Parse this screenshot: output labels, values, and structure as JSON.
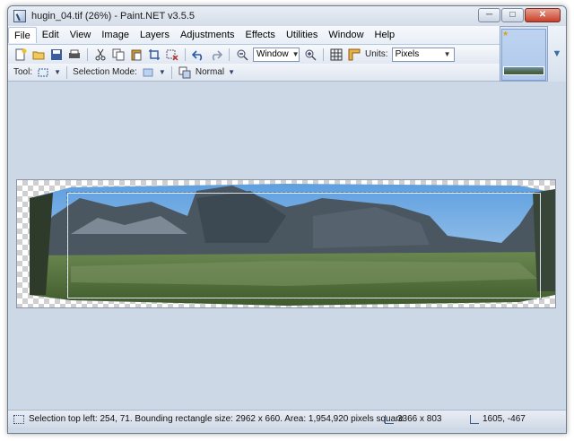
{
  "window": {
    "title": "hugin_04.tif (26%) - Paint.NET v3.5.5",
    "min_label": "─",
    "max_label": "□",
    "close_label": "✕"
  },
  "menu": {
    "items": [
      "File",
      "Edit",
      "View",
      "Image",
      "Layers",
      "Adjustments",
      "Effects",
      "Utilities",
      "Window",
      "Help"
    ]
  },
  "toolbar": {
    "zoom_value": "Window",
    "units_label": "Units:",
    "units_value": "Pixels"
  },
  "toolbar2": {
    "tool_label": "Tool:",
    "selection_mode_label": "Selection Mode:",
    "blend_value": "Normal"
  },
  "status": {
    "selection_text": "Selection top left: 254, 71. Bounding rectangle size: 2962 x 660. Area: 1,954,920 pixels square",
    "image_size": "3366 x 803",
    "cursor_pos": "1605, -467"
  },
  "colors": {
    "workspace": "#cdd8e6",
    "accent": "#3a6ea5",
    "sky": "#7fb0e0",
    "grass": "#4f6f3a",
    "rock": "#4a5660"
  }
}
